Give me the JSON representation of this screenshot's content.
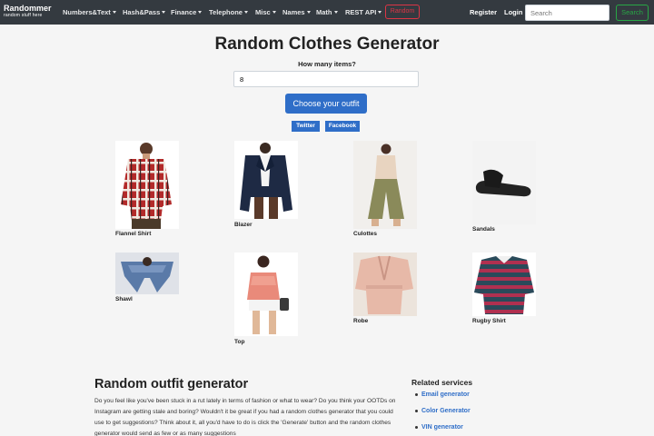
{
  "brand": {
    "name": "Randommer",
    "tagline": "random stuff here"
  },
  "nav": {
    "items": [
      "Numbers&Text",
      "Hash&Pass",
      "Finance",
      "Telephone",
      "Misc",
      "Names",
      "Math",
      "REST API"
    ],
    "random_label": "Random",
    "register_label": "Register",
    "login_label": "Login",
    "search_placeholder": "Search",
    "search_button": "Search"
  },
  "header": {
    "title": "Random Clothes Generator",
    "quantity_label": "How many items?",
    "quantity_value": "8",
    "choose_button": "Choose your outfit",
    "share_twitter": "Twitter",
    "share_facebook": "Facebook"
  },
  "items": [
    {
      "name": "Flannel Shirt"
    },
    {
      "name": "Blazer"
    },
    {
      "name": "Culottes"
    },
    {
      "name": "Sandals"
    },
    {
      "name": "Shawl"
    },
    {
      "name": "Top"
    },
    {
      "name": "Robe"
    },
    {
      "name": "Rugby Shirt"
    }
  ],
  "article": {
    "title": "Random outfit generator",
    "body": "Do you feel like you've been stuck in a rut lately in terms of fashion or what to wear? Do you think your OOTDs on Instagram are getting stale and boring? Wouldn't it be great if you had a random clothes generator that you could use to get suggestions? Think about it, all you'd have to do is click the 'Generate' button and the random clothes generator would send as few or as many suggestions"
  },
  "related": {
    "title": "Related services",
    "links": [
      "Email generator",
      "Color Generator",
      "VIN generator"
    ]
  },
  "colors": {
    "navbar": "#343a40",
    "primary": "#2f6ec8",
    "danger": "#dc3545",
    "success": "#28a745"
  }
}
